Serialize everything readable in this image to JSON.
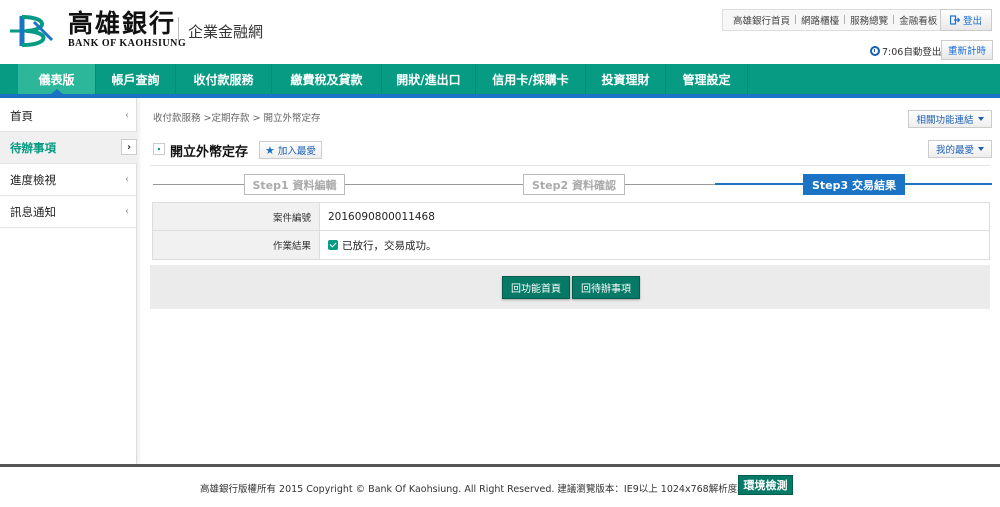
{
  "brand": {
    "name_cn": "高雄銀行",
    "name_en": "BANK OF KAOHSIUNG",
    "subtitle": "企業金融網",
    "logo_color": "#069b82"
  },
  "header": {
    "top_links": [
      "高雄銀行首頁",
      "網路櫃檯",
      "服務總覽",
      "金融看板"
    ],
    "logout_label": "登出",
    "session_timer": "7:06自動登出",
    "relogin_label": "重新計時"
  },
  "nav": {
    "tabs": [
      {
        "label": "儀表版",
        "active": true
      },
      {
        "label": "帳戶查詢"
      },
      {
        "label": "收付款服務"
      },
      {
        "label": "繳費稅及貸款"
      },
      {
        "label": "開狀/進出口"
      },
      {
        "label": "信用卡/採購卡"
      },
      {
        "label": "投資理財"
      },
      {
        "label": "管理設定"
      }
    ]
  },
  "sidebar": {
    "items": [
      {
        "label": "首頁"
      },
      {
        "label": "待辦事項",
        "active": true
      },
      {
        "label": "進度檢視"
      },
      {
        "label": "訊息通知"
      }
    ]
  },
  "main": {
    "breadcrumb": "收付款服務 >定期存款 > 開立外幣定存",
    "related_label": "相關功能連結",
    "my_fav_label": "我的最愛",
    "page_title": "開立外幣定存",
    "add_fav_label": "加入最愛",
    "steps": [
      {
        "label": "Step1 資料編輯",
        "state": "done"
      },
      {
        "label": "Step2 資料確認",
        "state": "done"
      },
      {
        "label": "Step3 交易結果",
        "state": "current"
      }
    ],
    "result": {
      "case_label": "案件編號",
      "case_value": "2016090800011468",
      "status_label": "作業結果",
      "status_value": "已放行，交易成功。"
    },
    "buttons": {
      "home_label": "回功能首頁",
      "todo_label": "回待辦事項"
    }
  },
  "footer": {
    "copyright": "高雄銀行版權所有 2015 Copyright © Bank Of Kaohsiung. All Right Reserved. 建議瀏覽版本：IE9以上 1024x768解析度為佳",
    "env_check_label": "環境檢測"
  }
}
